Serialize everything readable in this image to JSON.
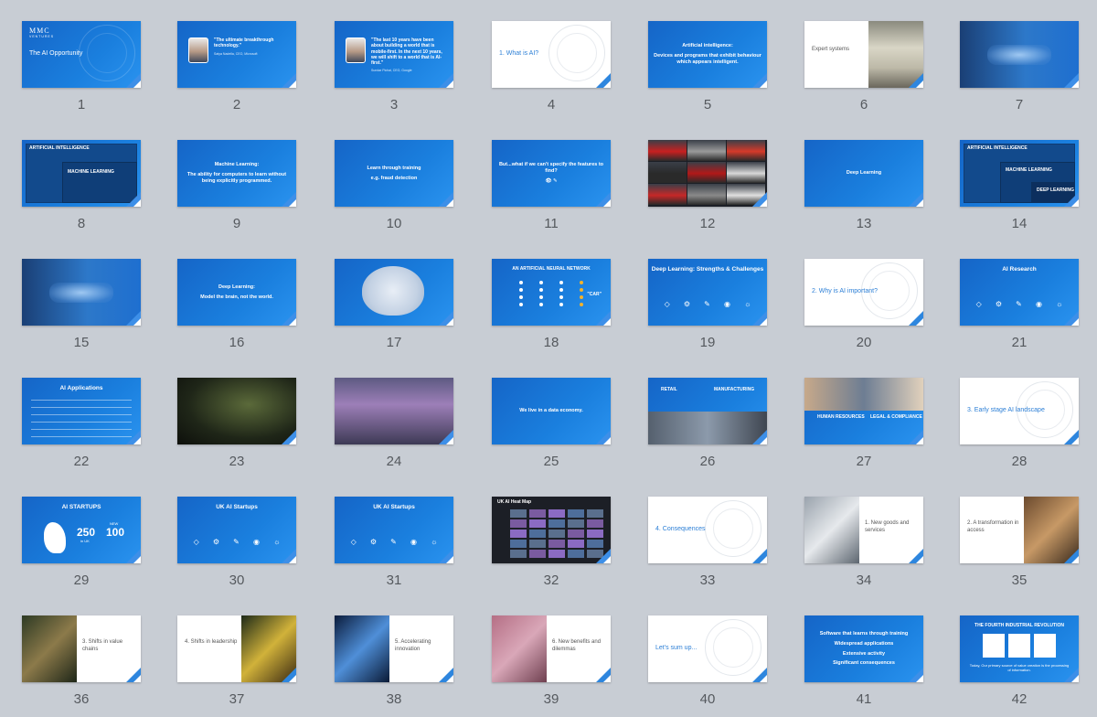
{
  "colors": {
    "background": "#c8cdd4",
    "slide_blue": "#1a7fde",
    "accent": "#2c7fd6",
    "number": "#55595e"
  },
  "slides": [
    {
      "number": "1",
      "style": "title",
      "title": "The AI Opportunity",
      "brand": "MMC",
      "brand_sub": "VENTURES"
    },
    {
      "number": "2",
      "style": "quote",
      "quote": "\"The ultimate breakthrough technology.\"",
      "attribution": "Satya Nadella, CEO, Microsoft"
    },
    {
      "number": "3",
      "style": "quote",
      "quote": "\"The last 10 years have been about building a world that is mobile-first. In the next 10 years, we will shift to a world that is AI-first.\"",
      "attribution": "Sundar Pichai, CEO, Google"
    },
    {
      "number": "4",
      "style": "section",
      "title": "1. What is AI?"
    },
    {
      "number": "5",
      "style": "center",
      "title": "Artificial intelligence:",
      "subtitle": "Devices and programs that exhibit behaviour which appears intelligent."
    },
    {
      "number": "6",
      "style": "split",
      "title": "Expert systems"
    },
    {
      "number": "7",
      "style": "photo",
      "title": ""
    },
    {
      "number": "8",
      "style": "nested",
      "labels": [
        "ARTIFICIAL INTELLIGENCE",
        "MACHINE LEARNING"
      ]
    },
    {
      "number": "9",
      "style": "center",
      "title": "Machine Learning:",
      "subtitle": "The ability for computers to learn without being explicitly programmed."
    },
    {
      "number": "10",
      "style": "center",
      "title": "Learn through training",
      "subtitle": "e.g. fraud detection"
    },
    {
      "number": "11",
      "style": "center",
      "title": "But...what if we can't specify the features to find?",
      "subtitle": "👁  ✎"
    },
    {
      "number": "12",
      "style": "cars",
      "title": ""
    },
    {
      "number": "13",
      "style": "center",
      "title": "Deep Learning",
      "subtitle": ""
    },
    {
      "number": "14",
      "style": "nested",
      "labels": [
        "ARTIFICIAL INTELLIGENCE",
        "MACHINE LEARNING",
        "DEEP LEARNING"
      ]
    },
    {
      "number": "15",
      "style": "photo",
      "title": ""
    },
    {
      "number": "16",
      "style": "center",
      "title": "Deep Learning:",
      "subtitle": "Model the brain, not the world."
    },
    {
      "number": "17",
      "style": "brain",
      "title": ""
    },
    {
      "number": "18",
      "style": "network",
      "title": "AN ARTIFICIAL NEURAL NETWORK",
      "subtitle": "\"CAR\""
    },
    {
      "number": "19",
      "style": "top",
      "title": "Deep Learning: Strengths & Challenges"
    },
    {
      "number": "20",
      "style": "section",
      "title": "2. Why is AI important?"
    },
    {
      "number": "21",
      "style": "top",
      "title": "AI Research"
    },
    {
      "number": "22",
      "style": "list",
      "title": "AI Applications"
    },
    {
      "number": "23",
      "style": "darkphoto",
      "title": ""
    },
    {
      "number": "24",
      "style": "darkphoto",
      "title": ""
    },
    {
      "number": "25",
      "style": "center",
      "title": "We live in a data economy.",
      "subtitle": ""
    },
    {
      "number": "26",
      "style": "two-col",
      "labels": [
        "RETAIL",
        "MANUFACTURING"
      ]
    },
    {
      "number": "27",
      "style": "two-col",
      "labels": [
        "HUMAN RESOURCES",
        "LEGAL & COMPLIANCE"
      ]
    },
    {
      "number": "28",
      "style": "section",
      "title": "3. Early stage AI landscape"
    },
    {
      "number": "29",
      "style": "startups",
      "title": "AI STARTUPS",
      "value1": "250",
      "value1_sub": "in UK",
      "value2": "100",
      "value2_sub": "NEW"
    },
    {
      "number": "30",
      "style": "top",
      "title": "UK AI Startups"
    },
    {
      "number": "31",
      "style": "top",
      "title": "UK AI Startups"
    },
    {
      "number": "32",
      "style": "map",
      "title": "UK AI Heat Map"
    },
    {
      "number": "33",
      "style": "section",
      "title": "4. Consequences"
    },
    {
      "number": "34",
      "style": "split-photo-left",
      "title": "1. New goods and services"
    },
    {
      "number": "35",
      "style": "split-photo-right",
      "title": "2. A transformation in access"
    },
    {
      "number": "36",
      "style": "split-photo-left",
      "title": "3. Shifts in value chains"
    },
    {
      "number": "37",
      "style": "split-photo-right",
      "title": "4. Shifts in leadership"
    },
    {
      "number": "38",
      "style": "split-photo-left",
      "title": "5. Accelerating innovation"
    },
    {
      "number": "39",
      "style": "split-photo-right",
      "title": "6. New benefits and dilemmas"
    },
    {
      "number": "40",
      "style": "section",
      "title": "Let's sum up..."
    },
    {
      "number": "41",
      "style": "lines",
      "lines": [
        "Software that learns through training",
        "Widespread applications",
        "Extensive activity",
        "Significant consequences"
      ]
    },
    {
      "number": "42",
      "style": "final",
      "title": "THE FOURTH INDUSTRIAL REVOLUTION",
      "subtitle": "Today, Our primary source of value creation is the processing of information."
    }
  ]
}
